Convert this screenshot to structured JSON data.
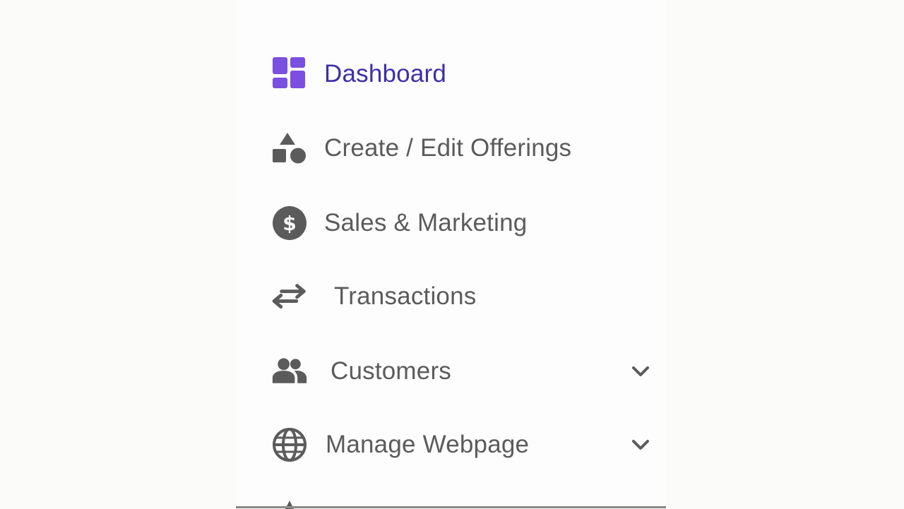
{
  "sidebar": {
    "items": [
      {
        "label": "Dashboard",
        "icon": "dashboard-icon",
        "active": true
      },
      {
        "label": "Create / Edit Offerings",
        "icon": "shapes-icon"
      },
      {
        "label": "Sales & Marketing",
        "icon": "dollar-circle-icon"
      },
      {
        "label": "Transactions",
        "icon": "arrows-exchange-icon"
      },
      {
        "label": "Customers",
        "icon": "people-icon",
        "expandable": true
      },
      {
        "label": "Manage Webpage",
        "icon": "globe-icon",
        "expandable": true
      }
    ]
  },
  "colors": {
    "active_text": "#3f2ea7",
    "active_icon": "#7b4fe0",
    "text": "#5b5b5b",
    "icon": "#5b5b5b"
  }
}
